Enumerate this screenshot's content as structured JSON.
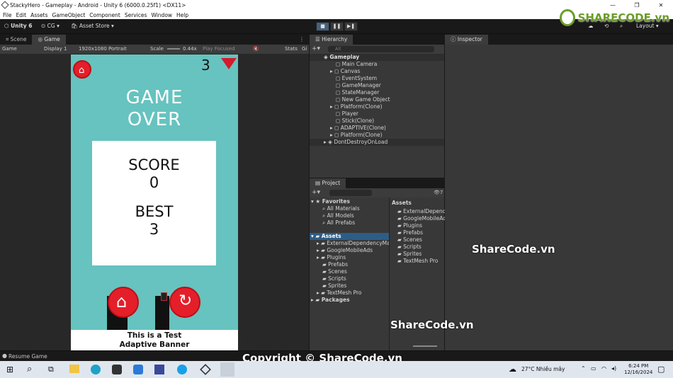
{
  "window": {
    "title": "StackyHero - Gameplay - Android - Unity 6 (6000.0.25f1) <DX11>"
  },
  "menu": [
    "File",
    "Edit",
    "Assets",
    "GameObject",
    "Component",
    "Services",
    "Window",
    "Help"
  ],
  "toolbar": {
    "account": "Unity 6",
    "cg": "CG",
    "asset_store": "Asset Store",
    "layout": "Layout"
  },
  "tabs": {
    "scene": "Scene",
    "game": "Game",
    "hierarchy": "Hierarchy",
    "project": "Project",
    "inspector": "Inspector"
  },
  "gamebar": {
    "mode": "Game",
    "display": "Display 1",
    "resolution": "1920x1080 Portrait",
    "scale_label": "Scale",
    "scale_value": "0.44x",
    "play_focused": "Play Focused",
    "stats": "Stats",
    "gizmos": "Gi"
  },
  "game": {
    "gem_count": "3",
    "game_over_1": "GAME",
    "game_over_2": "OVER",
    "score_label": "SCORE",
    "score_value": "0",
    "best_label": "BEST",
    "best_value": "3",
    "banner_1": "This is a Test",
    "banner_2": "Adaptive Banner",
    "bg_color": "#66c3bf",
    "button_color": "#e41f2a"
  },
  "hierarchy": {
    "search_placeholder": "All",
    "scene": "Gameplay",
    "items": [
      "Main Camera",
      "Canvas",
      "EventSystem",
      "GameManager",
      "StateManager",
      "New Game Object",
      "Platform(Clone)",
      "Player",
      "Stick(Clone)",
      "ADAPTIVE(Clone)",
      "Platform(Clone)"
    ],
    "dont_destroy": "DontDestroyOnLoad"
  },
  "project": {
    "favorites": "Favorites",
    "fav_items": [
      "All Materials",
      "All Models",
      "All Prefabs"
    ],
    "assets": "Assets",
    "asset_folders": [
      "ExternalDependencyMa",
      "GoogleMobileAds",
      "Plugins",
      "Prefabs",
      "Scenes",
      "Scripts",
      "Sprites",
      "TextMesh Pro"
    ],
    "packages": "Packages",
    "right_title": "Assets",
    "right_items": [
      "ExternalDepend",
      "GoogleMobileAc",
      "Plugins",
      "Prefabs",
      "Scenes",
      "Scripts",
      "Sprites",
      "TextMesh Pro"
    ],
    "count": "7"
  },
  "status": {
    "text": "Resume Game"
  },
  "watermarks": {
    "logo": "SHARECODE.vn",
    "mid": "ShareCode.vn",
    "bottom": "ShareCode.vn",
    "copyright": "Copyright © ShareCode.vn"
  },
  "taskbar": {
    "weather": "27°C  Nhiều mây",
    "time": "6:24 PM",
    "date": "12/16/2024"
  }
}
